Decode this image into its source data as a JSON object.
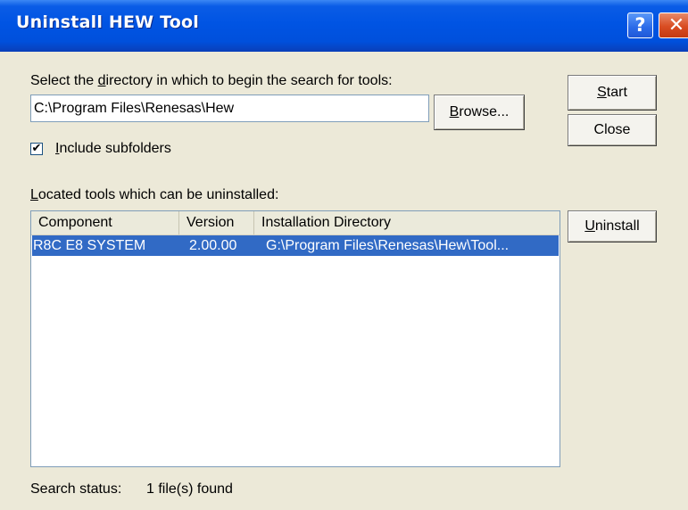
{
  "window": {
    "title": "Uninstall HEW Tool",
    "help_label": "?",
    "close_label": "✕"
  },
  "search": {
    "prompt_before": "Select the ",
    "prompt_mnemonic": "d",
    "prompt_after": "irectory in which to begin the search for tools:",
    "directory_value": "C:\\Program Files\\Renesas\\Hew",
    "browse_mnemonic": "B",
    "browse_after": "rowse..."
  },
  "buttons": {
    "start_mnemonic": "S",
    "start_after": "tart",
    "close_label": "Close",
    "uninstall_mnemonic": "U",
    "uninstall_after": "ninstall"
  },
  "options": {
    "include_subfolders_checked": true,
    "check_mark": "✔",
    "include_subfolders_mnemonic": "I",
    "include_subfolders_after": "nclude subfolders"
  },
  "tools": {
    "label_mnemonic": "L",
    "label_after": "ocated tools which can be uninstalled:",
    "columns": [
      "Component",
      "Version",
      "Installation Directory"
    ],
    "rows": [
      {
        "component": "R8C E8 SYSTEM",
        "version": "2.00.00",
        "directory": "G:\\Program Files\\Renesas\\Hew\\Tool...",
        "selected": true
      }
    ]
  },
  "status": {
    "label": "Search status:",
    "value": "1 file(s) found"
  },
  "colors": {
    "titlebar": "#0054e3",
    "dialog_bg": "#ece9d8",
    "selection": "#316ac5"
  }
}
